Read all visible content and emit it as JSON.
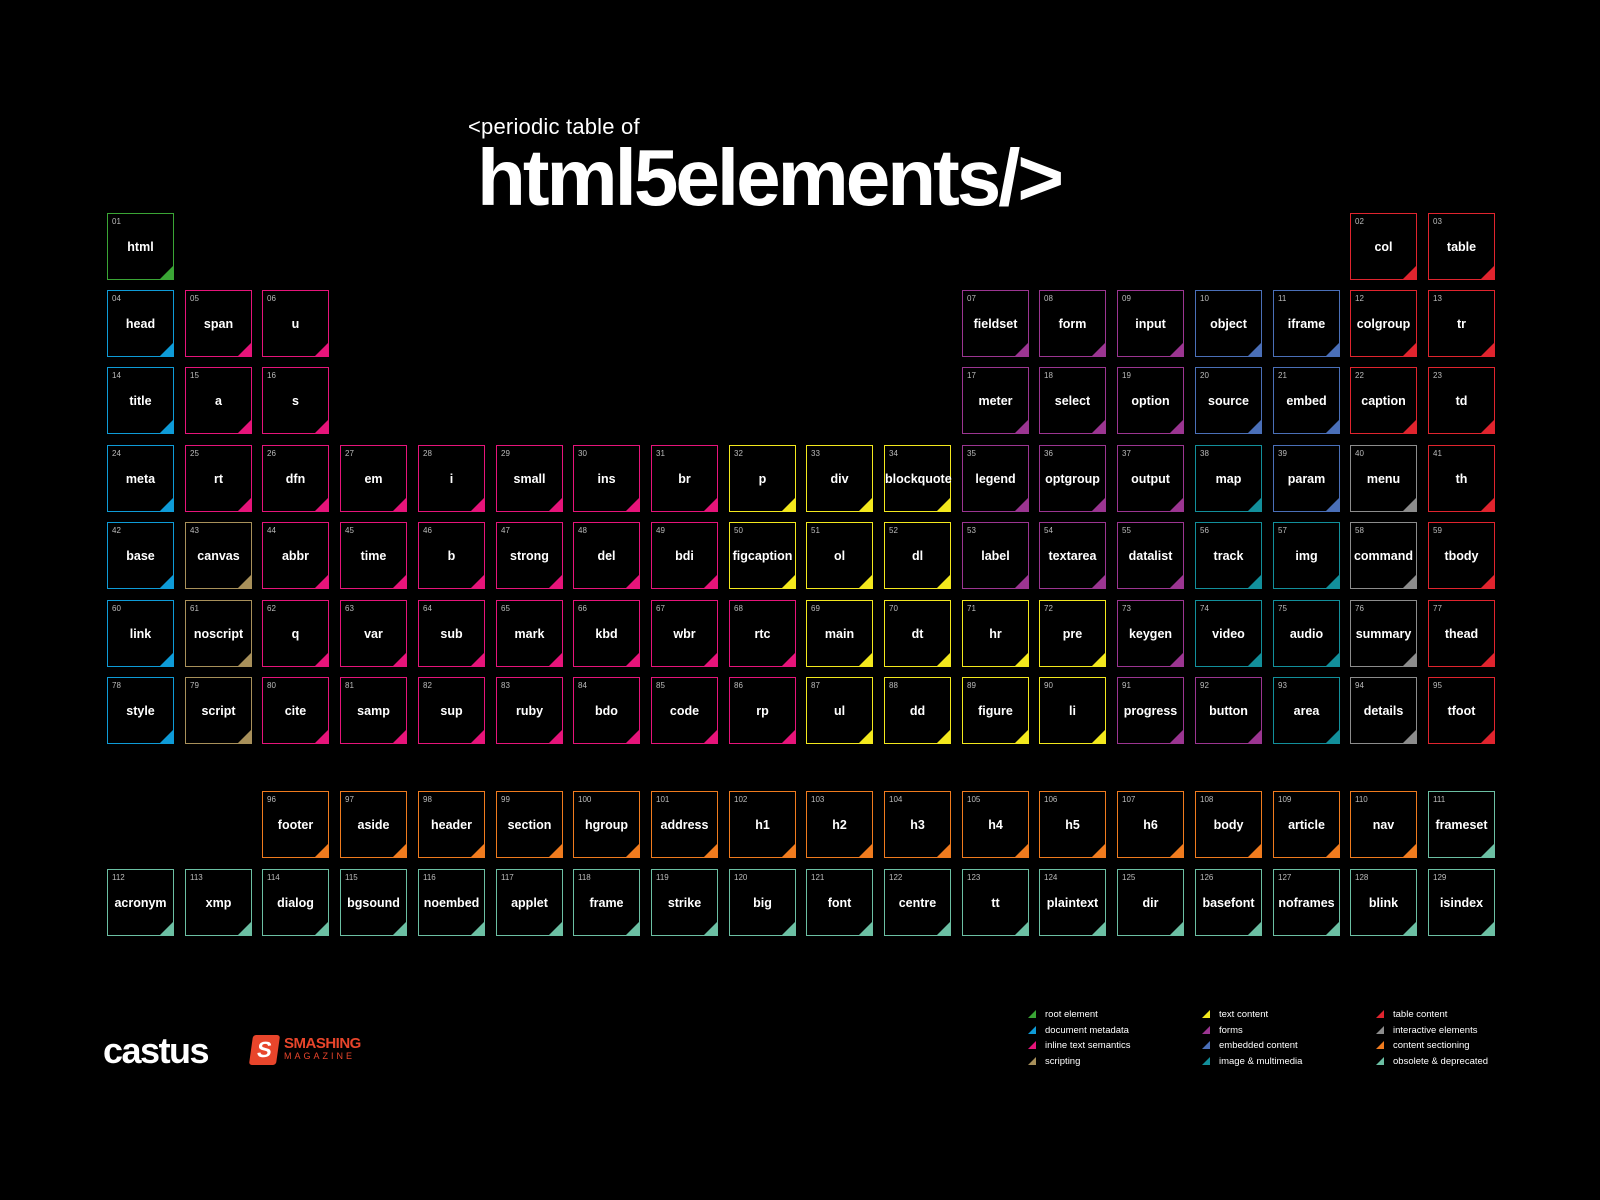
{
  "title": {
    "small": "<periodic table of",
    "big": "html5elements/>"
  },
  "categories": {
    "root": {
      "label": "root element",
      "color": "#3aa535"
    },
    "meta": {
      "label": "document metadata",
      "color": "#0e9bd7"
    },
    "inline": {
      "label": "inline text semantics",
      "color": "#e6147a"
    },
    "script": {
      "label": "scripting",
      "color": "#a8905a"
    },
    "text": {
      "label": "text content",
      "color": "#f3e81d"
    },
    "forms": {
      "label": "forms",
      "color": "#9b3591"
    },
    "embedded": {
      "label": "embedded content",
      "color": "#4a6fb8"
    },
    "media": {
      "label": "image & multimedia",
      "color": "#128f9b"
    },
    "table": {
      "label": "table content",
      "color": "#e0242e"
    },
    "interactive": {
      "label": "interactive elements",
      "color": "#8c8c8c"
    },
    "section": {
      "label": "content sectioning",
      "color": "#f07b1e"
    },
    "obsolete": {
      "label": "obsolete & deprecated",
      "color": "#6bbfa3"
    }
  },
  "legend_order": [
    [
      "root",
      "meta",
      "inline",
      "script"
    ],
    [
      "text",
      "forms",
      "embedded",
      "media"
    ],
    [
      "table",
      "interactive",
      "section",
      "obsolete"
    ]
  ],
  "elements": [
    {
      "num": "01",
      "sym": "html",
      "cat": "root",
      "col": 0,
      "row": 0
    },
    {
      "num": "02",
      "sym": "col",
      "cat": "table",
      "col": 16,
      "row": 0
    },
    {
      "num": "03",
      "sym": "table",
      "cat": "table",
      "col": 17,
      "row": 0
    },
    {
      "num": "04",
      "sym": "head",
      "cat": "meta",
      "col": 0,
      "row": 1
    },
    {
      "num": "05",
      "sym": "span",
      "cat": "inline",
      "col": 1,
      "row": 1
    },
    {
      "num": "06",
      "sym": "u",
      "cat": "inline",
      "col": 2,
      "row": 1
    },
    {
      "num": "07",
      "sym": "fieldset",
      "cat": "forms",
      "col": 11,
      "row": 1
    },
    {
      "num": "08",
      "sym": "form",
      "cat": "forms",
      "col": 12,
      "row": 1
    },
    {
      "num": "09",
      "sym": "input",
      "cat": "forms",
      "col": 13,
      "row": 1
    },
    {
      "num": "10",
      "sym": "object",
      "cat": "embedded",
      "col": 14,
      "row": 1
    },
    {
      "num": "11",
      "sym": "iframe",
      "cat": "embedded",
      "col": 15,
      "row": 1
    },
    {
      "num": "12",
      "sym": "colgroup",
      "cat": "table",
      "col": 16,
      "row": 1
    },
    {
      "num": "13",
      "sym": "tr",
      "cat": "table",
      "col": 17,
      "row": 1
    },
    {
      "num": "14",
      "sym": "title",
      "cat": "meta",
      "col": 0,
      "row": 2
    },
    {
      "num": "15",
      "sym": "a",
      "cat": "inline",
      "col": 1,
      "row": 2
    },
    {
      "num": "16",
      "sym": "s",
      "cat": "inline",
      "col": 2,
      "row": 2
    },
    {
      "num": "17",
      "sym": "meter",
      "cat": "forms",
      "col": 11,
      "row": 2
    },
    {
      "num": "18",
      "sym": "select",
      "cat": "forms",
      "col": 12,
      "row": 2
    },
    {
      "num": "19",
      "sym": "option",
      "cat": "forms",
      "col": 13,
      "row": 2
    },
    {
      "num": "20",
      "sym": "source",
      "cat": "embedded",
      "col": 14,
      "row": 2
    },
    {
      "num": "21",
      "sym": "embed",
      "cat": "embedded",
      "col": 15,
      "row": 2
    },
    {
      "num": "22",
      "sym": "caption",
      "cat": "table",
      "col": 16,
      "row": 2
    },
    {
      "num": "23",
      "sym": "td",
      "cat": "table",
      "col": 17,
      "row": 2
    },
    {
      "num": "24",
      "sym": "meta",
      "cat": "meta",
      "col": 0,
      "row": 3
    },
    {
      "num": "25",
      "sym": "rt",
      "cat": "inline",
      "col": 1,
      "row": 3
    },
    {
      "num": "26",
      "sym": "dfn",
      "cat": "inline",
      "col": 2,
      "row": 3
    },
    {
      "num": "27",
      "sym": "em",
      "cat": "inline",
      "col": 3,
      "row": 3
    },
    {
      "num": "28",
      "sym": "i",
      "cat": "inline",
      "col": 4,
      "row": 3
    },
    {
      "num": "29",
      "sym": "small",
      "cat": "inline",
      "col": 5,
      "row": 3
    },
    {
      "num": "30",
      "sym": "ins",
      "cat": "inline",
      "col": 6,
      "row": 3
    },
    {
      "num": "31",
      "sym": "br",
      "cat": "inline",
      "col": 7,
      "row": 3
    },
    {
      "num": "32",
      "sym": "p",
      "cat": "text",
      "col": 8,
      "row": 3
    },
    {
      "num": "33",
      "sym": "div",
      "cat": "text",
      "col": 9,
      "row": 3
    },
    {
      "num": "34",
      "sym": "blockquote",
      "cat": "text",
      "col": 10,
      "row": 3
    },
    {
      "num": "35",
      "sym": "legend",
      "cat": "forms",
      "col": 11,
      "row": 3
    },
    {
      "num": "36",
      "sym": "optgroup",
      "cat": "forms",
      "col": 12,
      "row": 3
    },
    {
      "num": "37",
      "sym": "output",
      "cat": "forms",
      "col": 13,
      "row": 3
    },
    {
      "num": "38",
      "sym": "map",
      "cat": "media",
      "col": 14,
      "row": 3
    },
    {
      "num": "39",
      "sym": "param",
      "cat": "embedded",
      "col": 15,
      "row": 3
    },
    {
      "num": "40",
      "sym": "menu",
      "cat": "interactive",
      "col": 16,
      "row": 3
    },
    {
      "num": "41",
      "sym": "th",
      "cat": "table",
      "col": 17,
      "row": 3
    },
    {
      "num": "42",
      "sym": "base",
      "cat": "meta",
      "col": 0,
      "row": 4
    },
    {
      "num": "43",
      "sym": "canvas",
      "cat": "script",
      "col": 1,
      "row": 4
    },
    {
      "num": "44",
      "sym": "abbr",
      "cat": "inline",
      "col": 2,
      "row": 4
    },
    {
      "num": "45",
      "sym": "time",
      "cat": "inline",
      "col": 3,
      "row": 4
    },
    {
      "num": "46",
      "sym": "b",
      "cat": "inline",
      "col": 4,
      "row": 4
    },
    {
      "num": "47",
      "sym": "strong",
      "cat": "inline",
      "col": 5,
      "row": 4
    },
    {
      "num": "48",
      "sym": "del",
      "cat": "inline",
      "col": 6,
      "row": 4
    },
    {
      "num": "49",
      "sym": "bdi",
      "cat": "inline",
      "col": 7,
      "row": 4
    },
    {
      "num": "50",
      "sym": "figcaption",
      "cat": "text",
      "col": 8,
      "row": 4
    },
    {
      "num": "51",
      "sym": "ol",
      "cat": "text",
      "col": 9,
      "row": 4
    },
    {
      "num": "52",
      "sym": "dl",
      "cat": "text",
      "col": 10,
      "row": 4
    },
    {
      "num": "53",
      "sym": "label",
      "cat": "forms",
      "col": 11,
      "row": 4
    },
    {
      "num": "54",
      "sym": "textarea",
      "cat": "forms",
      "col": 12,
      "row": 4
    },
    {
      "num": "55",
      "sym": "datalist",
      "cat": "forms",
      "col": 13,
      "row": 4
    },
    {
      "num": "56",
      "sym": "track",
      "cat": "media",
      "col": 14,
      "row": 4
    },
    {
      "num": "57",
      "sym": "img",
      "cat": "media",
      "col": 15,
      "row": 4
    },
    {
      "num": "58",
      "sym": "command",
      "cat": "interactive",
      "col": 16,
      "row": 4
    },
    {
      "num": "59",
      "sym": "tbody",
      "cat": "table",
      "col": 17,
      "row": 4
    },
    {
      "num": "60",
      "sym": "link",
      "cat": "meta",
      "col": 0,
      "row": 5
    },
    {
      "num": "61",
      "sym": "noscript",
      "cat": "script",
      "col": 1,
      "row": 5
    },
    {
      "num": "62",
      "sym": "q",
      "cat": "inline",
      "col": 2,
      "row": 5
    },
    {
      "num": "63",
      "sym": "var",
      "cat": "inline",
      "col": 3,
      "row": 5
    },
    {
      "num": "64",
      "sym": "sub",
      "cat": "inline",
      "col": 4,
      "row": 5
    },
    {
      "num": "65",
      "sym": "mark",
      "cat": "inline",
      "col": 5,
      "row": 5
    },
    {
      "num": "66",
      "sym": "kbd",
      "cat": "inline",
      "col": 6,
      "row": 5
    },
    {
      "num": "67",
      "sym": "wbr",
      "cat": "inline",
      "col": 7,
      "row": 5
    },
    {
      "num": "68",
      "sym": "rtc",
      "cat": "inline",
      "col": 8,
      "row": 5
    },
    {
      "num": "69",
      "sym": "main",
      "cat": "text",
      "col": 9,
      "row": 5
    },
    {
      "num": "70",
      "sym": "dt",
      "cat": "text",
      "col": 10,
      "row": 5
    },
    {
      "num": "71",
      "sym": "hr",
      "cat": "text",
      "col": 11,
      "row": 5
    },
    {
      "num": "72",
      "sym": "pre",
      "cat": "text",
      "col": 12,
      "row": 5
    },
    {
      "num": "73",
      "sym": "keygen",
      "cat": "forms",
      "col": 13,
      "row": 5
    },
    {
      "num": "74",
      "sym": "video",
      "cat": "media",
      "col": 14,
      "row": 5
    },
    {
      "num": "75",
      "sym": "audio",
      "cat": "media",
      "col": 15,
      "row": 5
    },
    {
      "num": "76",
      "sym": "summary",
      "cat": "interactive",
      "col": 16,
      "row": 5
    },
    {
      "num": "77",
      "sym": "thead",
      "cat": "table",
      "col": 17,
      "row": 5
    },
    {
      "num": "78",
      "sym": "style",
      "cat": "meta",
      "col": 0,
      "row": 6
    },
    {
      "num": "79",
      "sym": "script",
      "cat": "script",
      "col": 1,
      "row": 6
    },
    {
      "num": "80",
      "sym": "cite",
      "cat": "inline",
      "col": 2,
      "row": 6
    },
    {
      "num": "81",
      "sym": "samp",
      "cat": "inline",
      "col": 3,
      "row": 6
    },
    {
      "num": "82",
      "sym": "sup",
      "cat": "inline",
      "col": 4,
      "row": 6
    },
    {
      "num": "83",
      "sym": "ruby",
      "cat": "inline",
      "col": 5,
      "row": 6
    },
    {
      "num": "84",
      "sym": "bdo",
      "cat": "inline",
      "col": 6,
      "row": 6
    },
    {
      "num": "85",
      "sym": "code",
      "cat": "inline",
      "col": 7,
      "row": 6
    },
    {
      "num": "86",
      "sym": "rp",
      "cat": "inline",
      "col": 8,
      "row": 6
    },
    {
      "num": "87",
      "sym": "ul",
      "cat": "text",
      "col": 9,
      "row": 6
    },
    {
      "num": "88",
      "sym": "dd",
      "cat": "text",
      "col": 10,
      "row": 6
    },
    {
      "num": "89",
      "sym": "figure",
      "cat": "text",
      "col": 11,
      "row": 6
    },
    {
      "num": "90",
      "sym": "li",
      "cat": "text",
      "col": 12,
      "row": 6
    },
    {
      "num": "91",
      "sym": "progress",
      "cat": "forms",
      "col": 13,
      "row": 6
    },
    {
      "num": "92",
      "sym": "button",
      "cat": "forms",
      "col": 14,
      "row": 6
    },
    {
      "num": "93",
      "sym": "area",
      "cat": "media",
      "col": 15,
      "row": 6
    },
    {
      "num": "94",
      "sym": "details",
      "cat": "interactive",
      "col": 16,
      "row": 6
    },
    {
      "num": "95",
      "sym": "tfoot",
      "cat": "table",
      "col": 17,
      "row": 6
    },
    {
      "num": "96",
      "sym": "footer",
      "cat": "section",
      "col": 2,
      "row": 7
    },
    {
      "num": "97",
      "sym": "aside",
      "cat": "section",
      "col": 3,
      "row": 7
    },
    {
      "num": "98",
      "sym": "header",
      "cat": "section",
      "col": 4,
      "row": 7
    },
    {
      "num": "99",
      "sym": "section",
      "cat": "section",
      "col": 5,
      "row": 7
    },
    {
      "num": "100",
      "sym": "hgroup",
      "cat": "section",
      "col": 6,
      "row": 7
    },
    {
      "num": "101",
      "sym": "address",
      "cat": "section",
      "col": 7,
      "row": 7
    },
    {
      "num": "102",
      "sym": "h1",
      "cat": "section",
      "col": 8,
      "row": 7
    },
    {
      "num": "103",
      "sym": "h2",
      "cat": "section",
      "col": 9,
      "row": 7
    },
    {
      "num": "104",
      "sym": "h3",
      "cat": "section",
      "col": 10,
      "row": 7
    },
    {
      "num": "105",
      "sym": "h4",
      "cat": "section",
      "col": 11,
      "row": 7
    },
    {
      "num": "106",
      "sym": "h5",
      "cat": "section",
      "col": 12,
      "row": 7
    },
    {
      "num": "107",
      "sym": "h6",
      "cat": "section",
      "col": 13,
      "row": 7
    },
    {
      "num": "108",
      "sym": "body",
      "cat": "section",
      "col": 14,
      "row": 7
    },
    {
      "num": "109",
      "sym": "article",
      "cat": "section",
      "col": 15,
      "row": 7
    },
    {
      "num": "110",
      "sym": "nav",
      "cat": "section",
      "col": 16,
      "row": 7
    },
    {
      "num": "111",
      "sym": "frameset",
      "cat": "obsolete",
      "col": 17,
      "row": 7
    },
    {
      "num": "112",
      "sym": "acronym",
      "cat": "obsolete",
      "col": 0,
      "row": 8
    },
    {
      "num": "113",
      "sym": "xmp",
      "cat": "obsolete",
      "col": 1,
      "row": 8
    },
    {
      "num": "114",
      "sym": "dialog",
      "cat": "obsolete",
      "col": 2,
      "row": 8
    },
    {
      "num": "115",
      "sym": "bgsound",
      "cat": "obsolete",
      "col": 3,
      "row": 8
    },
    {
      "num": "116",
      "sym": "noembed",
      "cat": "obsolete",
      "col": 4,
      "row": 8
    },
    {
      "num": "117",
      "sym": "applet",
      "cat": "obsolete",
      "col": 5,
      "row": 8
    },
    {
      "num": "118",
      "sym": "frame",
      "cat": "obsolete",
      "col": 6,
      "row": 8
    },
    {
      "num": "119",
      "sym": "strike",
      "cat": "obsolete",
      "col": 7,
      "row": 8
    },
    {
      "num": "120",
      "sym": "big",
      "cat": "obsolete",
      "col": 8,
      "row": 8
    },
    {
      "num": "121",
      "sym": "font",
      "cat": "obsolete",
      "col": 9,
      "row": 8
    },
    {
      "num": "122",
      "sym": "centre",
      "cat": "obsolete",
      "col": 10,
      "row": 8
    },
    {
      "num": "123",
      "sym": "tt",
      "cat": "obsolete",
      "col": 11,
      "row": 8
    },
    {
      "num": "124",
      "sym": "plaintext",
      "cat": "obsolete",
      "col": 12,
      "row": 8
    },
    {
      "num": "125",
      "sym": "dir",
      "cat": "obsolete",
      "col": 13,
      "row": 8
    },
    {
      "num": "126",
      "sym": "basefont",
      "cat": "obsolete",
      "col": 14,
      "row": 8
    },
    {
      "num": "127",
      "sym": "noframes",
      "cat": "obsolete",
      "col": 15,
      "row": 8
    },
    {
      "num": "128",
      "sym": "blink",
      "cat": "obsolete",
      "col": 16,
      "row": 8
    },
    {
      "num": "129",
      "sym": "isindex",
      "cat": "obsolete",
      "col": 17,
      "row": 8
    }
  ],
  "logos": {
    "castus": "castus",
    "smashing_icon": "S",
    "smashing_name": "SMASHING",
    "smashing_sub": "MAGAZINE"
  }
}
